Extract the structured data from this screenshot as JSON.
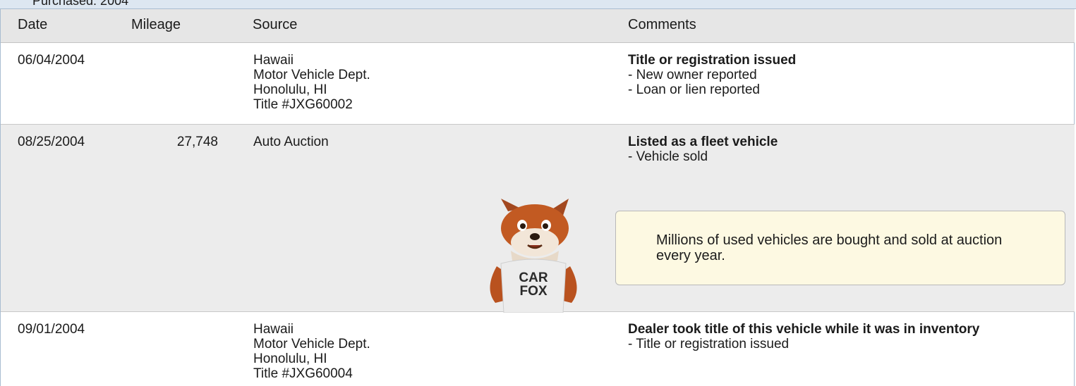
{
  "owner_strip": {
    "label": "Purchased: 2004"
  },
  "table": {
    "headers": [
      "Date",
      "Mileage",
      "Source",
      "Comments"
    ],
    "rows": [
      {
        "date": "06/04/2004",
        "mileage": "",
        "source": [
          "Hawaii",
          "Motor Vehicle Dept.",
          "Honolulu, HI",
          "Title #JXG60002"
        ],
        "comment_title": "Title or registration issued",
        "comment_items": [
          "- New owner reported",
          "- Loan or lien reported"
        ]
      },
      {
        "date": "08/25/2004",
        "mileage": "27,748",
        "source": [
          "Auto Auction"
        ],
        "comment_title": "Listed as a fleet vehicle",
        "comment_items": [
          "- Vehicle sold"
        ]
      },
      {
        "date": "09/01/2004",
        "mileage": "",
        "source": [
          "Hawaii",
          "Motor Vehicle Dept.",
          "Honolulu, HI",
          "Title #JXG60004"
        ],
        "comment_title": "Dealer took title of this vehicle while it was in inventory",
        "comment_items": [
          "- Title or registration issued"
        ]
      }
    ]
  },
  "callout": {
    "text": "Millions of used vehicles are bought and sold at auction every year."
  },
  "mascot": {
    "shirt_line1": "CAR",
    "shirt_line2": "FOX",
    "icon": "carfox-mascot"
  },
  "colors": {
    "header_bg": "#e6e6e6",
    "alt_row_bg": "#ececec",
    "callout_bg": "#fdf9e2",
    "owner_strip_bg": "#dde7f1"
  }
}
